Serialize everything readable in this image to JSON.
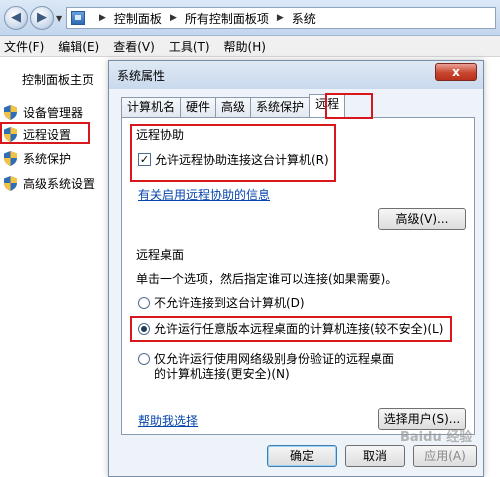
{
  "nav": {
    "back_glyph": "◀",
    "forward_glyph": "▶",
    "breadcrumbs": [
      "控制面板",
      "所有控制面板项",
      "系统"
    ]
  },
  "menu": [
    "文件(F)",
    "编辑(E)",
    "查看(V)",
    "工具(T)",
    "帮助(H)"
  ],
  "left_pane": {
    "home": "控制面板主页",
    "items": [
      "设备管理器",
      "远程设置",
      "系统保护",
      "高级系统设置"
    ],
    "selected_index": 1
  },
  "dialog": {
    "title": "系统属性",
    "close_glyph": "x",
    "tabs": [
      "计算机名",
      "硬件",
      "高级",
      "系统保护",
      "远程"
    ],
    "active_tab": 4,
    "assist": {
      "title": "远程协助",
      "checkbox_label": "允许远程协助连接这台计算机(R)",
      "checked": true,
      "link": "有关启用远程协助的信息",
      "advanced_button": "高级(V)..."
    },
    "desktop": {
      "title": "远程桌面",
      "description": "单击一个选项，然后指定谁可以连接(如果需要)。",
      "options": [
        "不允许连接到这台计算机(D)",
        "允许运行任意版本远程桌面的计算机连接(较不安全)(L)",
        "仅允许运行使用网络级别身份验证的远程桌面的计算机连接(更安全)(N)"
      ],
      "selected_option": 1,
      "help_link": "帮助我选择",
      "select_users_button": "选择用户(S)..."
    },
    "buttons": {
      "ok": "确定",
      "cancel": "取消",
      "apply": "应用(A)"
    }
  },
  "watermark": "Baidu 经验",
  "colors": {
    "highlight": "#d8171c",
    "link": "#0645ad",
    "dialog_bg": "#eef3f9"
  }
}
